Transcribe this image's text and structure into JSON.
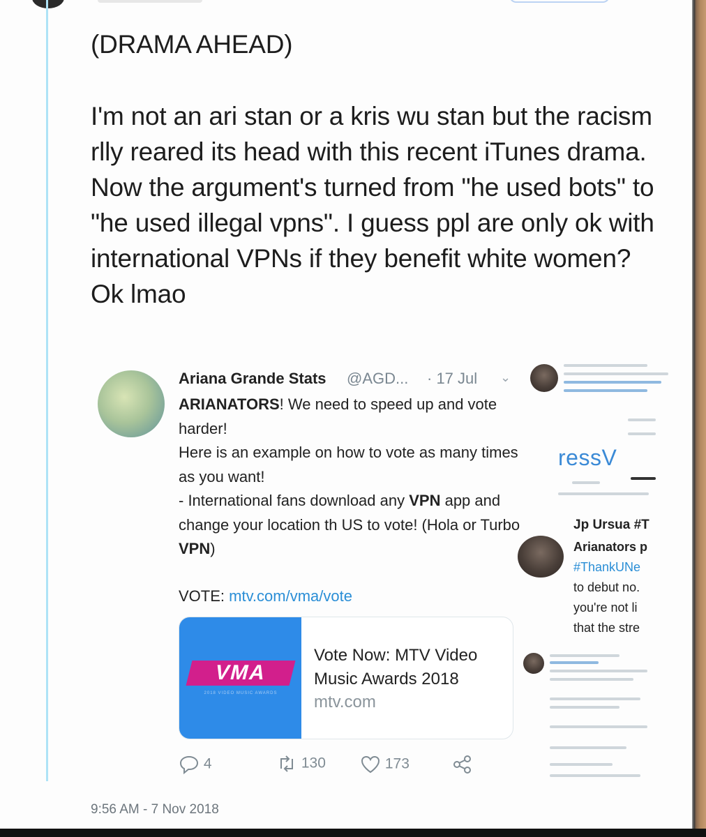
{
  "tweet": {
    "heading": "(DRAMA AHEAD)",
    "body": "I'm not an ari stan or a kris wu stan but the racism rlly reared its head with this recent iTunes drama. Now the argument's turned from \"he used bots\" to \"he used illegal vpns\". I guess ppl are only ok with international VPNs if they benefit white women? Ok lmao",
    "timestamp": "9:56 AM - 7 Nov 2018",
    "reply_count": "4",
    "retweet_count": "130",
    "like_count": "173"
  },
  "quoted": {
    "name": "Ariana Grande Stats",
    "handle": "@AGD...",
    "date": "· 17 Jul",
    "text_lead": "ARIANATORS",
    "text_1": "! We need to speed up and vote harder!",
    "text_2": "Here is an example on how to vote as many times as you want!",
    "text_3a": "- International fans download any ",
    "text_3b": "VPN",
    "text_3c": " app and change your location th US to vote! (Hola or Turbo ",
    "text_3d": "VPN",
    "text_3e": ")",
    "vote_label": "VOTE: ",
    "vote_link": "mtv.com/vma/vote",
    "card": {
      "logo": "VMA",
      "logo_sub": "2018 VIDEO MUSIC AWARDS",
      "title": "Vote Now: MTV Video Music Awards 2018",
      "domain": "mtv.com"
    }
  },
  "background": {
    "press_fragment": "ressV",
    "jp_name": "Jp Ursua #T",
    "jp_lines": [
      "Arianators p",
      "#ThankUNe",
      "to debut no.",
      "you're not li",
      "that the stre"
    ]
  },
  "colors": {
    "thread_line": "#aee3f6",
    "link": "#2a8ed6",
    "card_image": "#2e8be8",
    "vma_logo": "#d21f8c"
  }
}
